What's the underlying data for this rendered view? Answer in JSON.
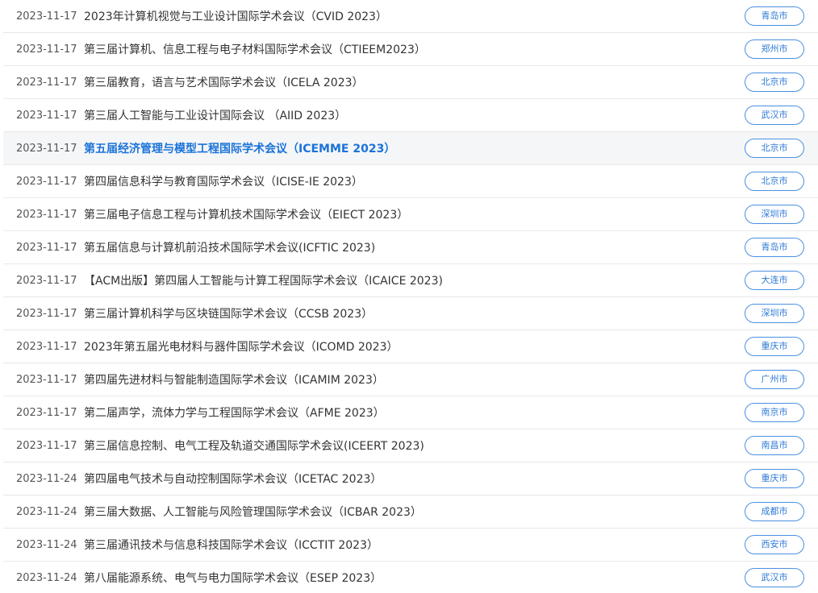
{
  "conferences": [
    {
      "date": "2023-11-17",
      "title": "2023年计算机视觉与工业设计国际学术会议（CVID 2023）",
      "city": "青岛市"
    },
    {
      "date": "2023-11-17",
      "title": "第三届计算机、信息工程与电子材料国际学术会议（CTIEEM2023）",
      "city": "郑州市"
    },
    {
      "date": "2023-11-17",
      "title": "第三届教育，语言与艺术国际学术会议（ICELA 2023）",
      "city": "北京市"
    },
    {
      "date": "2023-11-17",
      "title": "第三届人工智能与工业设计国际会议 （AIID 2023）",
      "city": "武汉市"
    },
    {
      "date": "2023-11-17",
      "title": "第五届经济管理与模型工程国际学术会议（ICEMME 2023）",
      "city": "北京市",
      "highlighted": true
    },
    {
      "date": "2023-11-17",
      "title": "第四届信息科学与教育国际学术会议（ICISE-IE 2023）",
      "city": "北京市"
    },
    {
      "date": "2023-11-17",
      "title": "第三届电子信息工程与计算机技术国际学术会议（EIECT 2023）",
      "city": "深圳市"
    },
    {
      "date": "2023-11-17",
      "title": "第五届信息与计算机前沿技术国际学术会议(ICFTIC 2023)",
      "city": "青岛市"
    },
    {
      "date": "2023-11-17",
      "title": "【ACM出版】第四届人工智能与计算工程国际学术会议（ICAICE 2023)",
      "city": "大连市"
    },
    {
      "date": "2023-11-17",
      "title": "第三届计算机科学与区块链国际学术会议（CCSB 2023）",
      "city": "深圳市"
    },
    {
      "date": "2023-11-17",
      "title": "2023年第五届光电材料与器件国际学术会议（ICOMD 2023）",
      "city": "重庆市"
    },
    {
      "date": "2023-11-17",
      "title": "第四届先进材料与智能制造国际学术会议（ICAMIM 2023）",
      "city": "广州市"
    },
    {
      "date": "2023-11-17",
      "title": "第二届声学，流体力学与工程国际学术会议（AFME 2023）",
      "city": "南京市"
    },
    {
      "date": "2023-11-17",
      "title": "第三届信息控制、电气工程及轨道交通国际学术会议(ICEERT 2023)",
      "city": "南昌市"
    },
    {
      "date": "2023-11-24",
      "title": "第四届电气技术与自动控制国际学术会议（ICETAC 2023）",
      "city": "重庆市"
    },
    {
      "date": "2023-11-24",
      "title": "第三届大数据、人工智能与风险管理国际学术会议（ICBAR 2023）",
      "city": "成都市"
    },
    {
      "date": "2023-11-24",
      "title": "第三届通讯技术与信息科技国际学术会议（ICCTIT 2023）",
      "city": "西安市"
    },
    {
      "date": "2023-11-24",
      "title": "第八届能源系统、电气与电力国际学术会议（ESEP 2023）",
      "city": "武汉市"
    }
  ],
  "colors": {
    "accent": "#1a73d9",
    "badge_border": "#4a90e2",
    "row_highlight_bg": "#f5f6f8",
    "divider": "#e8e8e8"
  }
}
